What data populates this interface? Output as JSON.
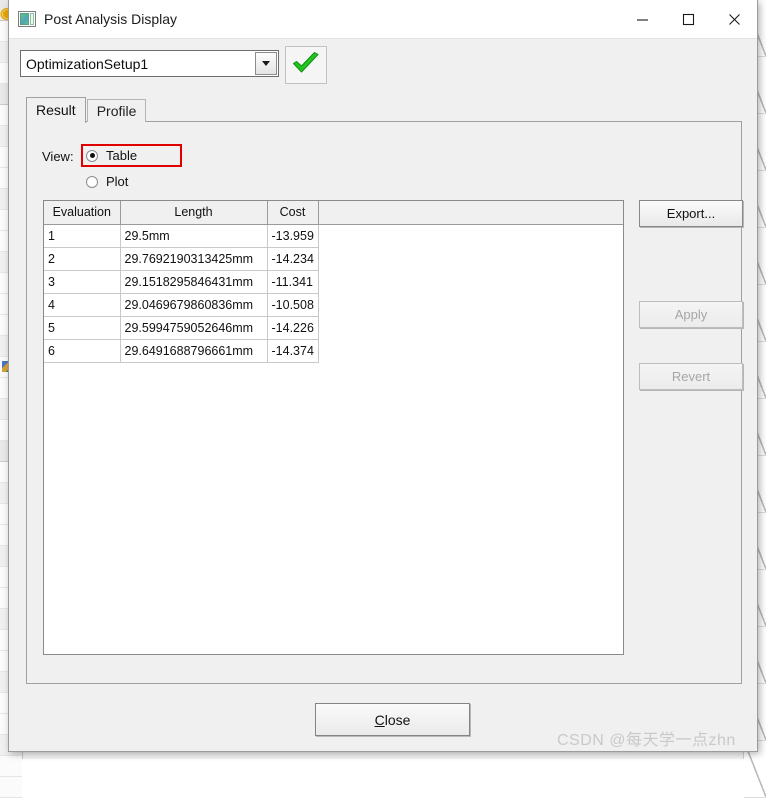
{
  "window": {
    "title": "Post Analysis Display",
    "icon": "display-window-icon",
    "controls": {
      "minimize": "minimize-icon",
      "maximize": "maximize-icon",
      "close": "close-icon"
    }
  },
  "toolbar": {
    "setup_combo": {
      "value": "OptimizationSetup1",
      "arrow": "chevron-down-icon"
    },
    "validate_button": {
      "icon": "green-checkmark-icon",
      "color": "#22c521"
    }
  },
  "tabs": [
    {
      "label": "Result",
      "active": true
    },
    {
      "label": "Profile",
      "active": false
    }
  ],
  "view": {
    "label": "View:",
    "options": [
      {
        "label": "Table",
        "selected": true,
        "highlighted": true
      },
      {
        "label": "Plot",
        "selected": false,
        "highlighted": false
      }
    ],
    "highlight_color": "#e00000"
  },
  "table": {
    "columns": [
      "Evaluation",
      "Length",
      "Cost",
      ""
    ],
    "rows": [
      {
        "evaluation": "1",
        "length": "29.5mm",
        "cost": "-13.959"
      },
      {
        "evaluation": "2",
        "length": "29.7692190313425mm",
        "cost": "-14.234"
      },
      {
        "evaluation": "3",
        "length": "29.1518295846431mm",
        "cost": "-11.341"
      },
      {
        "evaluation": "4",
        "length": "29.0469679860836mm",
        "cost": "-10.508"
      },
      {
        "evaluation": "5",
        "length": "29.5994759052646mm",
        "cost": "-14.226"
      },
      {
        "evaluation": "6",
        "length": "29.6491688796661mm",
        "cost": "-14.374"
      }
    ]
  },
  "side_buttons": [
    {
      "label": "Export...",
      "enabled": true
    },
    {
      "label": "Apply",
      "enabled": false
    },
    {
      "label": "Revert",
      "enabled": false
    }
  ],
  "footer": {
    "close_accel": "C",
    "close_rest": "lose"
  },
  "watermark": {
    "text": "CSDN @每天学一点zhn"
  }
}
